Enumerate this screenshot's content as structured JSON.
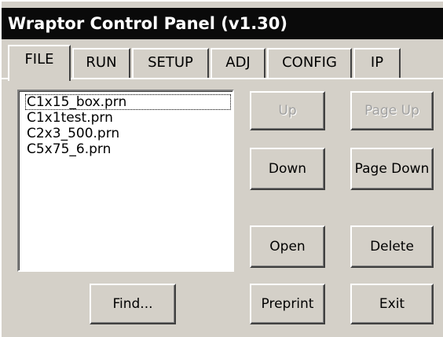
{
  "window": {
    "title": "Wraptor Control Panel (v1.30)"
  },
  "tabs": [
    {
      "label": "FILE",
      "active": true
    },
    {
      "label": "RUN",
      "active": false
    },
    {
      "label": "SETUP",
      "active": false
    },
    {
      "label": "ADJ",
      "active": false
    },
    {
      "label": "CONFIG",
      "active": false
    },
    {
      "label": "IP",
      "active": false
    }
  ],
  "file_list": {
    "items": [
      "C1x15_box.prn",
      "C1x1test.prn",
      "C2x3_500.prn",
      "C5x75_6.prn"
    ],
    "selected_index": 0
  },
  "buttons": {
    "up": {
      "label": "Up",
      "enabled": false
    },
    "page_up": {
      "label": "Page Up",
      "enabled": false
    },
    "down": {
      "label": "Down",
      "enabled": true
    },
    "page_down": {
      "label": "Page Down",
      "enabled": true
    },
    "open": {
      "label": "Open",
      "enabled": true
    },
    "delete": {
      "label": "Delete",
      "enabled": true
    },
    "find": {
      "label": "Find...",
      "enabled": true
    },
    "preprint": {
      "label": "Preprint",
      "enabled": true
    },
    "exit": {
      "label": "Exit",
      "enabled": true
    }
  },
  "colors": {
    "titlebar_bg": "#0a0a0a",
    "titlebar_text": "#ffffff",
    "face": "#d4d0c8",
    "disabled_text": "#a0a0a0"
  }
}
